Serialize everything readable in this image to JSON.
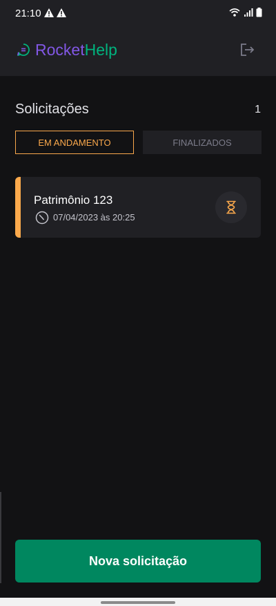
{
  "status_bar": {
    "time": "21:10"
  },
  "header": {
    "brand_part1": "Rocket",
    "brand_part2": "Help"
  },
  "main": {
    "title": "Solicitações",
    "count": "1",
    "tabs": [
      {
        "label": "EM ANDAMENTO",
        "active": true
      },
      {
        "label": "FINALIZADOS",
        "active": false
      }
    ],
    "orders": [
      {
        "title": "Patrimônio 123",
        "date": "07/04/2023 às 20:25",
        "status": "open"
      }
    ]
  },
  "footer": {
    "new_button_label": "Nova solicitação"
  },
  "colors": {
    "background": "#121214",
    "surface": "#202024",
    "open": "#fba94c",
    "primary": "#00875f",
    "brand_purple": "#8257e5",
    "brand_green": "#00b37e"
  },
  "icons": [
    "warning-icon",
    "wifi-icon",
    "signal-icon",
    "battery-icon",
    "chat-logo-icon",
    "sign-out-icon",
    "clock-icon",
    "hourglass-icon"
  ]
}
